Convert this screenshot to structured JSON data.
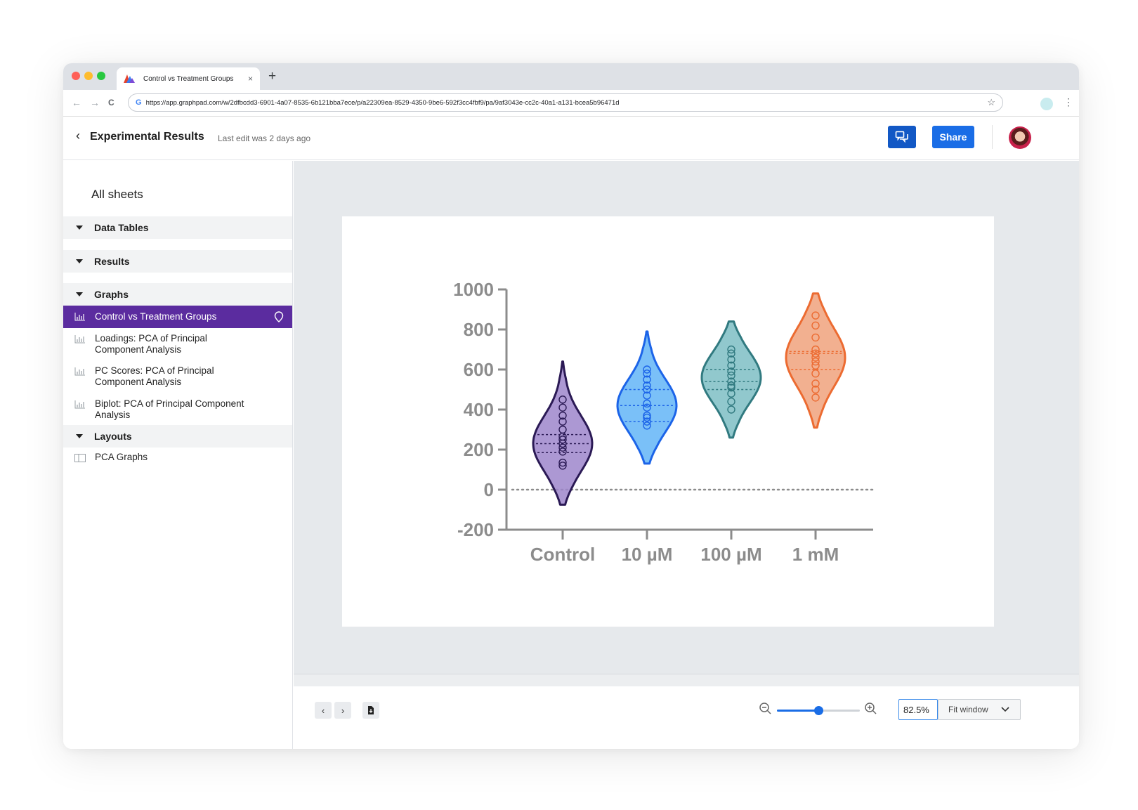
{
  "browser": {
    "tab_title": "Control vs Treatment Groups",
    "tab_close": "×",
    "new_tab": "+",
    "url": "https://app.graphpad.com/w/2dfbcdd3-6901-4a07-8535-6b121bba7ece/p/a22309ea-8529-4350-9be6-592f3cc4fbf9/pa/9af3043e-cc2c-40a1-a131-bcea5b96471d",
    "back": "←",
    "forward": "→",
    "reload": "C",
    "google": "G",
    "star": "☆",
    "menu": "⋮"
  },
  "header": {
    "back": "‹",
    "title": "Experimental Results",
    "last_edit": "Last edit was 2 days ago",
    "share_label": "Share"
  },
  "sidebar": {
    "title": "All sheets",
    "sections": [
      {
        "label": "Data Tables"
      },
      {
        "label": "Results"
      },
      {
        "label": "Graphs"
      },
      {
        "label": "Layouts"
      }
    ],
    "graphs": [
      {
        "label": "Control vs Treatment Groups",
        "active": true
      },
      {
        "label": "Loadings: PCA of Principal Component Analysis"
      },
      {
        "label": "PC Scores: PCA of Principal Component Analysis"
      },
      {
        "label": "Biplot: PCA of Principal Component Analysis"
      }
    ],
    "layouts": [
      {
        "label": "PCA Graphs"
      }
    ]
  },
  "toolbar": {
    "prev": "‹",
    "next": "›",
    "zoom_percent": 0.5,
    "zoom_value": "82.5%",
    "fit_label": "Fit window"
  },
  "colors": {
    "accent": "#1a6de6",
    "active_item": "#5b2c9f"
  },
  "chart_data": {
    "type": "violin",
    "categories": [
      "Control",
      "10 µM",
      "100 µM",
      "1 mM"
    ],
    "yticks": [
      "1000",
      "800",
      "600",
      "400",
      "200",
      "0",
      "-200"
    ],
    "ylim": [
      -200,
      1000
    ],
    "reference_line": 0,
    "series": [
      {
        "category": "Control",
        "fill": "#9d86cb",
        "stroke": "#2b1a55",
        "min": -75,
        "max": 640,
        "median": 230,
        "q1": 185,
        "q3": 275,
        "peak": 230,
        "points": [
          120,
          135,
          190,
          210,
          230,
          250,
          265,
          300,
          340,
          370,
          410,
          450
        ]
      },
      {
        "category": "10 µM",
        "fill": "#63b5f7",
        "stroke": "#1c64e8",
        "min": 130,
        "max": 790,
        "median": 420,
        "q1": 340,
        "q3": 500,
        "peak": 420,
        "points": [
          320,
          340,
          360,
          370,
          410,
          430,
          470,
          500,
          520,
          550,
          580,
          600
        ]
      },
      {
        "category": "100 µM",
        "fill": "#7ebec4",
        "stroke": "#317a80",
        "min": 260,
        "max": 840,
        "median": 540,
        "q1": 500,
        "q3": 600,
        "peak": 560,
        "points": [
          400,
          440,
          480,
          510,
          520,
          540,
          570,
          590,
          620,
          650,
          680,
          700
        ]
      },
      {
        "category": "1 mM",
        "fill": "#f0a27d",
        "stroke": "#ec6b31",
        "min": 310,
        "max": 980,
        "median": 680,
        "q1": 600,
        "q3": 690,
        "peak": 660,
        "points": [
          460,
          500,
          530,
          580,
          620,
          640,
          660,
          680,
          700,
          760,
          820,
          870
        ]
      }
    ]
  }
}
